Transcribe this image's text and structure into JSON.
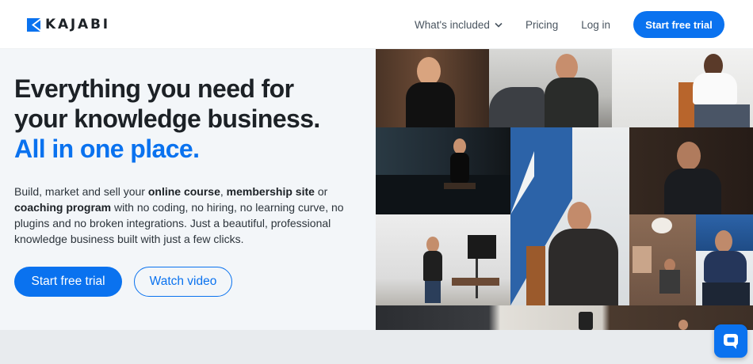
{
  "brand": {
    "name": "KAJABI",
    "color": "#0a72ef"
  },
  "nav": {
    "whats_included": "What's included",
    "pricing": "Pricing",
    "login": "Log in",
    "cta": "Start free trial"
  },
  "hero": {
    "headline_line1": "Everything you need for",
    "headline_line2": "your knowledge business.",
    "headline_accent": "All in one place.",
    "desc": {
      "t1": "Build, market and sell your ",
      "b1": "online course",
      "t2": ", ",
      "b2": "membership site",
      "t3": " or ",
      "b3": "coaching program",
      "t4": " with no coding, no hiring, no learning curve, no plugins and no broken integrations. Just a beautiful, professional knowledge business built with just a few clicks."
    },
    "primary_button": "Start free trial",
    "secondary_button": "Watch video"
  },
  "collage": {
    "tiles": [
      "woman-smiling-photo",
      "man-motorcycle-photo",
      "man-chair-gesturing-photo",
      "woman-seated-studio-photo",
      "man-sitting-blue-wall-photo",
      "man-portrait-photo",
      "woman-presenting-studio-photo",
      "man-interview-photo",
      "office-room-photo",
      "man-seated-right-photo"
    ]
  },
  "chat": {
    "icon": "chat-bubble-icon"
  }
}
